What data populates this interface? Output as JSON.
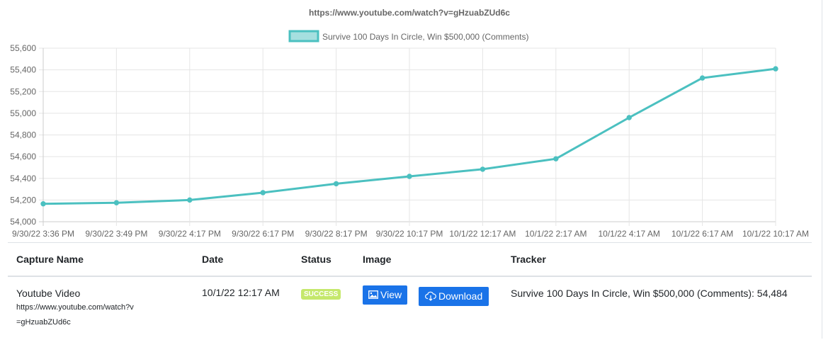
{
  "chart_data": {
    "type": "line",
    "title": "https://www.youtube.com/watch?v=gHzuabZUd6c",
    "categories": [
      "9/30/22 3:36 PM",
      "9/30/22 3:49 PM",
      "9/30/22 4:17 PM",
      "9/30/22 6:17 PM",
      "9/30/22 8:17 PM",
      "9/30/22 10:17 PM",
      "10/1/22 12:17 AM",
      "10/1/22 2:17 AM",
      "10/1/22 4:17 AM",
      "10/1/22 6:17 AM",
      "10/1/22 10:17 AM"
    ],
    "series": [
      {
        "name": "Survive 100 Days In Circle, Win $500,000 (Comments)",
        "values": [
          54165,
          54175,
          54200,
          54268,
          54350,
          54418,
          54484,
          54580,
          54960,
          55325,
          55410
        ],
        "color": "#4bc0c0",
        "legend_fill": "#a5dfdf"
      }
    ],
    "ylim": [
      54000,
      55600
    ],
    "yticks": [
      54000,
      54200,
      54400,
      54600,
      54800,
      55000,
      55200,
      55400,
      55600
    ],
    "ytick_labels": [
      "54,000",
      "54,200",
      "54,400",
      "54,600",
      "54,800",
      "55,000",
      "55,200",
      "55,400",
      "55,600"
    ],
    "grid": true,
    "legend_position": "top"
  },
  "table": {
    "headers": {
      "name": "Capture Name",
      "date": "Date",
      "status": "Status",
      "image": "Image",
      "tracker": "Tracker"
    },
    "rows": [
      {
        "name": "Youtube Video",
        "url": "https://www.youtube.com/watch?v=gHzuabZUd6c",
        "date": "10/1/22 12:17 AM",
        "status": "SUCCESS",
        "view_label": "View",
        "download_label": "Download",
        "tracker": "Survive 100 Days In Circle, Win $500,000 (Comments): 54,484"
      }
    ]
  },
  "colors": {
    "primary": "#1a73e8",
    "success": "#c5e86c",
    "line": "#4bc0c0",
    "grid": "#e5e5e5"
  },
  "icons": {
    "view": "image-icon",
    "download": "cloud-download-icon"
  }
}
